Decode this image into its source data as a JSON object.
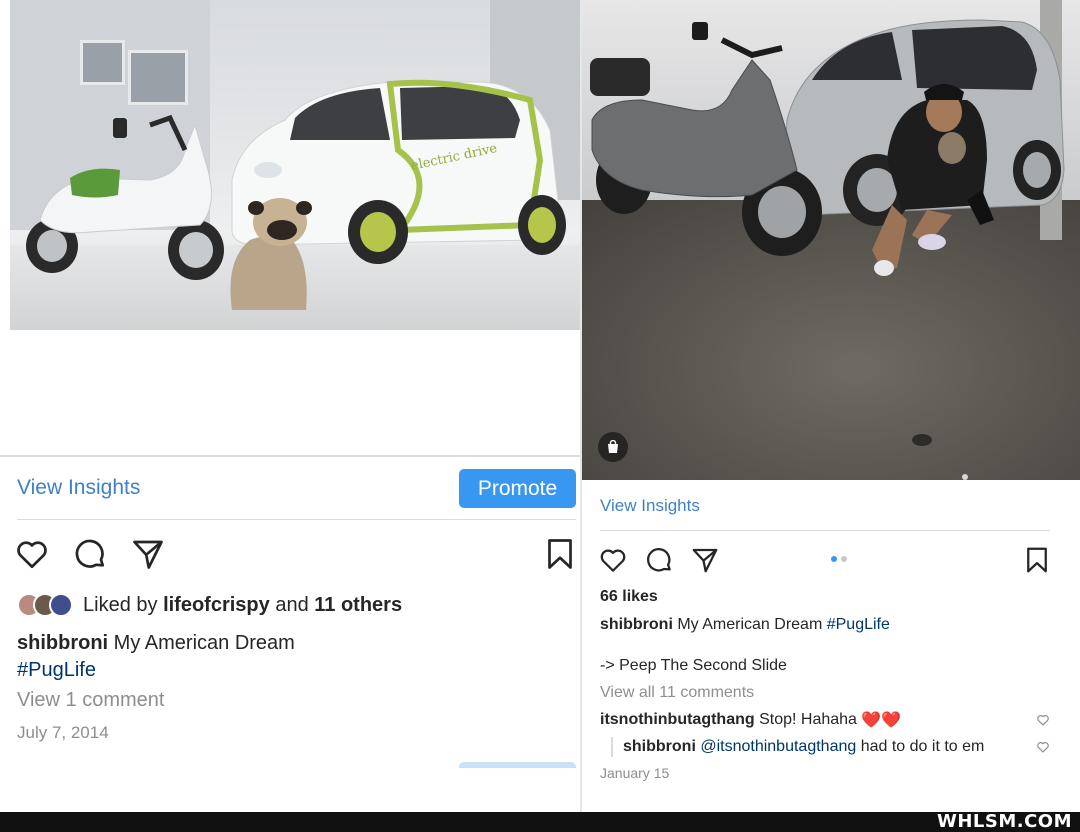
{
  "left_post": {
    "insights_label": "View Insights",
    "promote_label": "Promote",
    "liked_by_prefix": "Liked by",
    "liked_by_user": "lifeofcrispy",
    "liked_by_and": "and",
    "liked_by_others": "11 others",
    "caption_user": "shibbroni",
    "caption_text": "My American Dream",
    "caption_hashtag": "#PugLife",
    "photo_text": "electric drive",
    "view_comments": "View 1 comment",
    "date": "July 7, 2014",
    "icons": [
      "heart-icon",
      "comment-icon",
      "share-icon",
      "bookmark-icon"
    ]
  },
  "right_post": {
    "insights_label": "View Insights",
    "likes": "66 likes",
    "caption_user": "shibbroni",
    "caption_text": "My American Dream",
    "caption_hashtag": "#PugLife",
    "caption_line2": "-> Peep The Second Slide",
    "view_all_comments": "View all 11 comments",
    "comments": [
      {
        "user": "itsnothinbutagthang",
        "text": "Stop! Hahaha",
        "emoji": "❤️❤️"
      },
      {
        "user": "shibbroni",
        "mention": "@itsnothinbutagthang",
        "text": "had to do it to em"
      }
    ],
    "date": "January 15",
    "carousel": {
      "count": 2,
      "active": 1
    },
    "icons": [
      "heart-icon",
      "comment-icon",
      "share-icon",
      "bookmark-icon",
      "shopping-bag-icon"
    ]
  },
  "watermark": "WHLSM.COM",
  "colors": {
    "link_blue": "#3e82c4",
    "button_blue": "#3897f0",
    "hashtag": "#003569",
    "muted": "#8e8e8e",
    "text": "#262626"
  }
}
